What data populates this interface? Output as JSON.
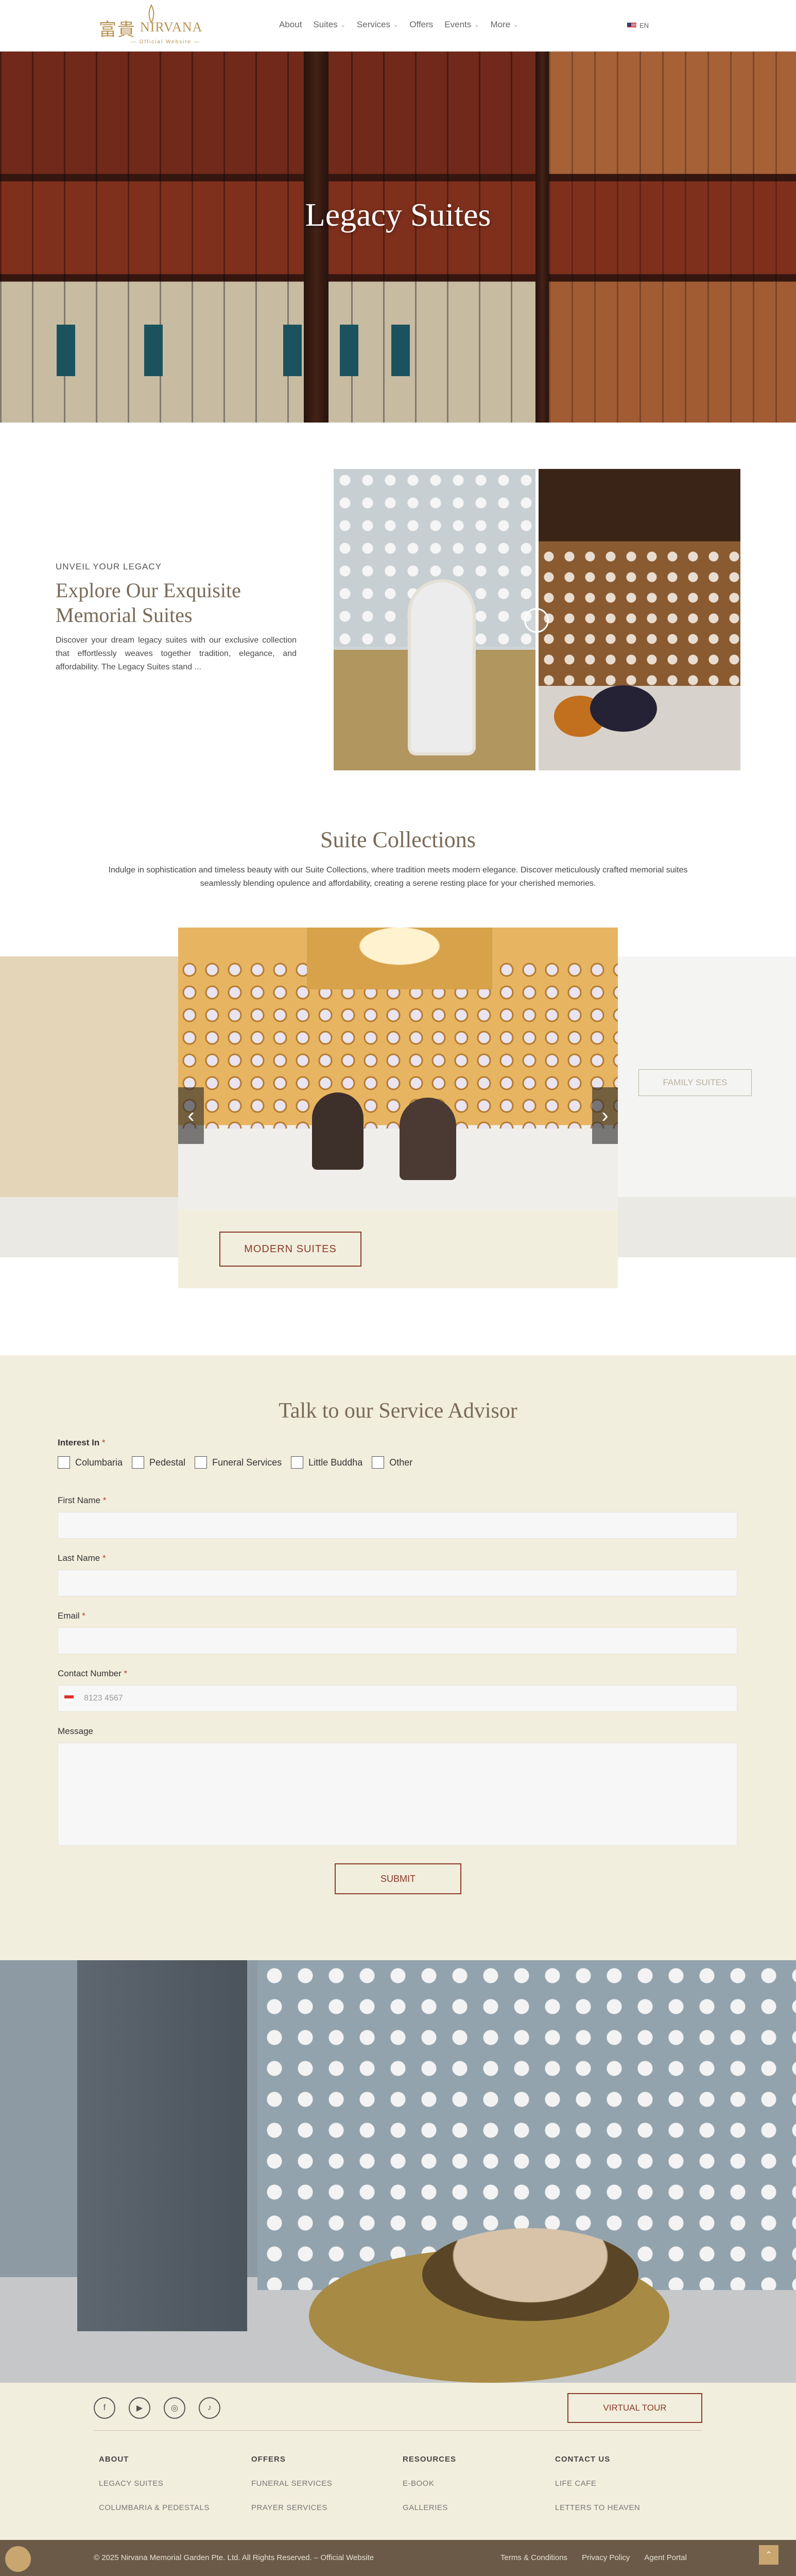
{
  "header": {
    "logo_cn": "富貴",
    "logo_en": "NIRVANA",
    "logo_sub": "— Official Website —",
    "nav": [
      {
        "label": "About",
        "has_menu": false
      },
      {
        "label": "Suites",
        "has_menu": true
      },
      {
        "label": "Services",
        "has_menu": true
      },
      {
        "label": "Offers",
        "has_menu": false
      },
      {
        "label": "Events",
        "has_menu": true
      },
      {
        "label": "More",
        "has_menu": true
      }
    ],
    "lang": "EN"
  },
  "hero": {
    "title": "Legacy Suites"
  },
  "intro": {
    "eyebrow": "UNVEIL YOUR LEGACY",
    "title": "Explore Our Exquisite Memorial Suites",
    "body": "Discover your dream legacy suites with our exclusive collection that effortlessly weaves together tradition, elegance, and affordability. The Legacy Suites stand ..."
  },
  "suites": {
    "title": "Suite Collections",
    "body": "Indulge in sophistication and timeless beauty with our Suite Collections, where tradition meets modern elegance. Discover meticulously crafted memorial suites seamlessly blending opulence and affordability, creating a serene resting place for your cherished memories.",
    "active_slide_button": "MODERN SUITES",
    "next_slide_button": "FAMILY SUITES"
  },
  "form": {
    "title": "Talk to our Service Advisor",
    "interest_label": "Interest In",
    "interests": [
      "Columbaria",
      "Pedestal",
      "Funeral Services",
      "Little Buddha",
      "Other"
    ],
    "first_name_label": "First Name",
    "last_name_label": "Last Name",
    "email_label": "Email",
    "contact_label": "Contact Number",
    "contact_placeholder": "8123 4567",
    "message_label": "Message",
    "submit_label": "SUBMIT",
    "required_mark": "*"
  },
  "footer": {
    "virtual_tour": "VIRTUAL TOUR",
    "columns": [
      {
        "heading": "ABOUT",
        "links": [
          "LEGACY SUITES",
          "COLUMBARIA & PEDESTALS"
        ]
      },
      {
        "heading": "OFFERS",
        "links": [
          "FUNERAL SERVICES",
          "PRAYER SERVICES"
        ]
      },
      {
        "heading": "RESOURCES",
        "links": [
          "E-BOOK",
          "GALLERIES"
        ]
      },
      {
        "heading": "CONTACT US",
        "links": [
          "LIFE CAFE",
          "LETTERS TO HEAVEN"
        ]
      }
    ],
    "copyright": "© 2025 Nirvana Memorial Garden Pte. Ltd. All Rights Reserved. – Official Website",
    "bottom_links": [
      "Terms & Conditions",
      "Privacy Policy",
      "Agent Portal"
    ]
  },
  "colors": {
    "accent_gold": "#b89354",
    "button_maroon": "#8a3a2a",
    "section_cream": "#f2eedd",
    "footer_bar": "#6b5a48"
  },
  "icons": {
    "social": [
      "facebook-icon",
      "youtube-icon",
      "instagram-icon",
      "tiktok-icon"
    ]
  }
}
